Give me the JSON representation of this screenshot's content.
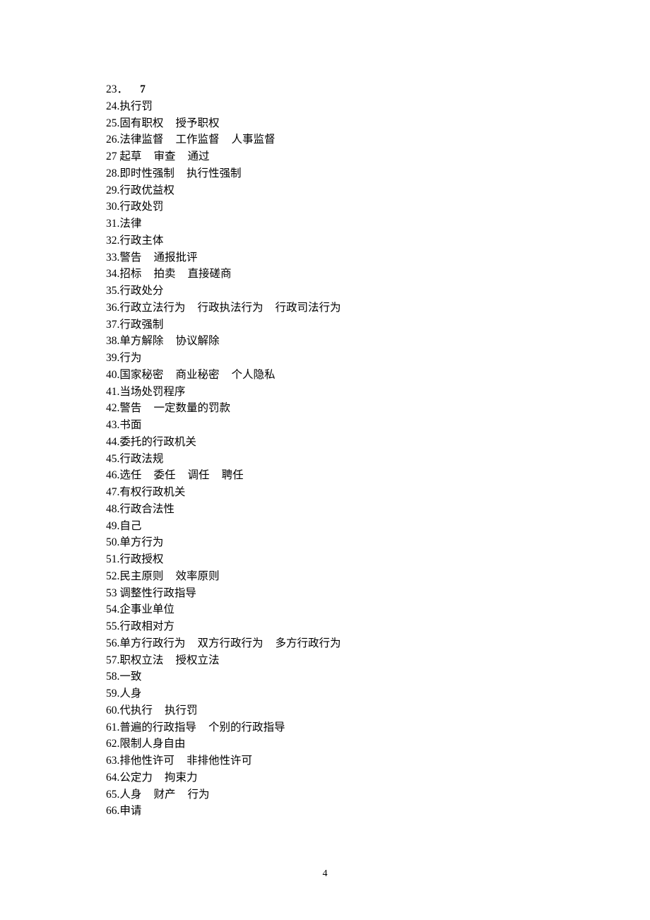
{
  "page_number": "4",
  "items": [
    {
      "n": "23",
      "dot": "．",
      "parts": [
        "7"
      ],
      "bold_parts": true,
      "pad": true
    },
    {
      "n": "24",
      "dot": ".",
      "parts": [
        "执行罚"
      ]
    },
    {
      "n": "25",
      "dot": ".",
      "parts": [
        "固有职权",
        "授予职权"
      ]
    },
    {
      "n": "26",
      "dot": ".",
      "parts": [
        "法律监督",
        "工作监督",
        "人事监督"
      ]
    },
    {
      "n": "27",
      "dot": " ",
      "parts": [
        "起草",
        "审查",
        "通过"
      ]
    },
    {
      "n": "28",
      "dot": ".",
      "parts": [
        "即时性强制",
        "执行性强制"
      ]
    },
    {
      "n": "29",
      "dot": ".",
      "parts": [
        "行政优益权"
      ]
    },
    {
      "n": "30",
      "dot": ".",
      "parts": [
        "行政处罚"
      ]
    },
    {
      "n": "31",
      "dot": ".",
      "parts": [
        "法律"
      ]
    },
    {
      "n": "32",
      "dot": ".",
      "parts": [
        "行政主体"
      ]
    },
    {
      "n": "33",
      "dot": ".",
      "parts": [
        "警告",
        "通报批评"
      ]
    },
    {
      "n": "34",
      "dot": ".",
      "parts": [
        "招标",
        "拍卖",
        "直接磋商"
      ]
    },
    {
      "n": "35",
      "dot": ".",
      "parts": [
        "行政处分"
      ]
    },
    {
      "n": "36",
      "dot": ".",
      "parts": [
        "行政立法行为",
        "行政执法行为",
        "行政司法行为"
      ]
    },
    {
      "n": "37",
      "dot": ".",
      "parts": [
        "行政强制"
      ]
    },
    {
      "n": "38",
      "dot": ".",
      "parts": [
        "单方解除",
        "协议解除"
      ]
    },
    {
      "n": "39",
      "dot": ".",
      "parts": [
        "行为"
      ]
    },
    {
      "n": "40",
      "dot": ".",
      "parts": [
        "国家秘密",
        "商业秘密",
        "个人隐私"
      ]
    },
    {
      "n": "41",
      "dot": ".",
      "parts": [
        "当场处罚程序"
      ]
    },
    {
      "n": "42",
      "dot": ".",
      "parts": [
        "警告",
        "一定数量的罚款"
      ]
    },
    {
      "n": "43",
      "dot": ".",
      "parts": [
        "书面"
      ]
    },
    {
      "n": "44",
      "dot": ".",
      "parts": [
        "委托的行政机关"
      ]
    },
    {
      "n": "45",
      "dot": ".",
      "parts": [
        "行政法规"
      ]
    },
    {
      "n": "46",
      "dot": ".",
      "parts": [
        "选任",
        "委任",
        "调任",
        "聘任"
      ]
    },
    {
      "n": "47",
      "dot": ".",
      "parts": [
        "有权行政机关"
      ]
    },
    {
      "n": "48",
      "dot": ".",
      "parts": [
        "行政合法性"
      ]
    },
    {
      "n": "49",
      "dot": ".",
      "parts": [
        "自己"
      ]
    },
    {
      "n": "50",
      "dot": ".",
      "parts": [
        "单方行为"
      ]
    },
    {
      "n": "51",
      "dot": ".",
      "parts": [
        "行政授权"
      ]
    },
    {
      "n": "52",
      "dot": ".",
      "parts": [
        "民主原则",
        "效率原则"
      ]
    },
    {
      "n": "53",
      "dot": " ",
      "parts": [
        "调整性行政指导"
      ]
    },
    {
      "n": "54",
      "dot": ".",
      "parts": [
        "企事业单位"
      ]
    },
    {
      "n": "55",
      "dot": ".",
      "parts": [
        "行政相对方"
      ]
    },
    {
      "n": "56",
      "dot": ".",
      "parts": [
        "单方行政行为",
        "双方行政行为",
        "多方行政行为"
      ]
    },
    {
      "n": "57",
      "dot": ".",
      "parts": [
        "职权立法",
        "授权立法"
      ]
    },
    {
      "n": "58",
      "dot": ".",
      "parts": [
        "一致"
      ]
    },
    {
      "n": "59",
      "dot": ".",
      "parts": [
        "人身"
      ]
    },
    {
      "n": "60",
      "dot": ".",
      "parts": [
        "代执行",
        "执行罚"
      ]
    },
    {
      "n": "61",
      "dot": ".",
      "parts": [
        "普遍的行政指导",
        "个别的行政指导"
      ]
    },
    {
      "n": "62",
      "dot": ".",
      "parts": [
        "限制人身自由"
      ]
    },
    {
      "n": "63",
      "dot": ".",
      "parts": [
        "排他性许可",
        "非排他性许可"
      ]
    },
    {
      "n": "64",
      "dot": ".",
      "parts": [
        "公定力",
        "拘束力"
      ]
    },
    {
      "n": "65",
      "dot": ".",
      "parts": [
        "人身",
        "财产",
        "行为"
      ]
    },
    {
      "n": "66",
      "dot": ".",
      "parts": [
        "申请"
      ]
    }
  ]
}
